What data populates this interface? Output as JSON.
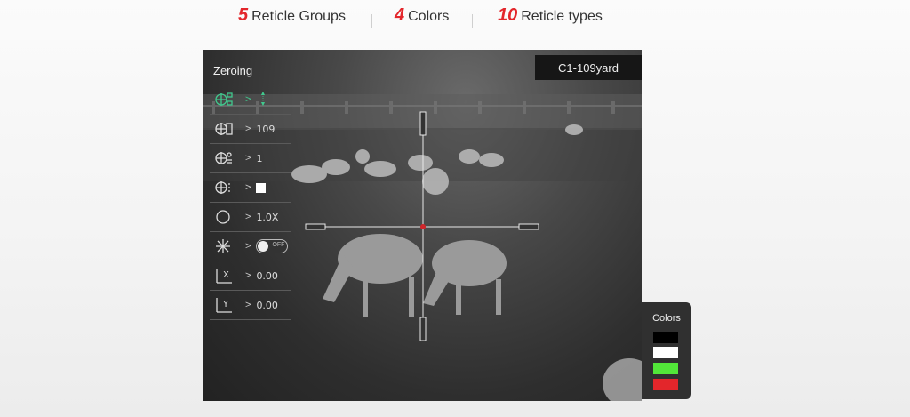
{
  "stats": [
    {
      "number": "5",
      "label": "Reticle Groups"
    },
    {
      "number": "4",
      "label": "Colors"
    },
    {
      "number": "10",
      "label": "Reticle types"
    }
  ],
  "scope": {
    "range_label": "C1-109yard",
    "menu_title": "Zeroing",
    "menu": {
      "reticle_group": {
        "icon": "reticle-group-icon",
        "value": ""
      },
      "distance": {
        "icon": "distance-reticle-icon",
        "value": "109"
      },
      "reticle_type": {
        "icon": "reticle-type-icon",
        "value": "1"
      },
      "color": {
        "icon": "reticle-color-icon",
        "value": ""
      },
      "zoom": {
        "icon": "zoom-circle-icon",
        "value": "1.0X"
      },
      "freeze": {
        "icon": "snowflake-icon",
        "toggle_state": "OFF"
      },
      "x_offset": {
        "icon": "x-axis-icon",
        "value": "0.00"
      },
      "y_offset": {
        "icon": "y-axis-icon",
        "value": "0.00"
      }
    },
    "arrow": ">",
    "accent_color": "#41c98e",
    "center_dot_color": "#d0262b"
  },
  "colors_panel": {
    "title": "Colors",
    "swatches": [
      "#000000",
      "#ffffff",
      "#52e639",
      "#e3262b"
    ]
  }
}
